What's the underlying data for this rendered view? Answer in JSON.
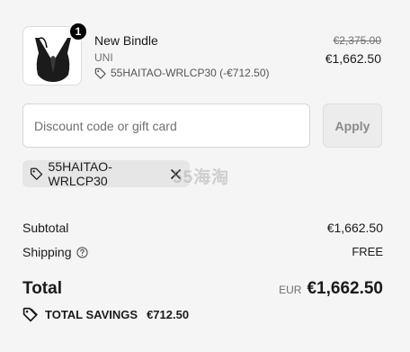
{
  "product": {
    "quantity": "1",
    "name": "New Bindle",
    "variant": "UNI",
    "discount_line": "55HAITAO-WRLCP30 (-€712.50)",
    "original_price": "€2,375.00",
    "price": "€1,662.50",
    "image_icon": "handbag-icon"
  },
  "discount": {
    "placeholder": "Discount code or gift card",
    "apply_label": "Apply",
    "applied_code": "55HAITAO-WRLCP30",
    "watermark": "55海淘"
  },
  "summary": {
    "subtotal_label": "Subtotal",
    "subtotal_value": "€1,662.50",
    "shipping_label": "Shipping",
    "shipping_value": "FREE",
    "total_label": "Total",
    "total_currency": "EUR",
    "total_value": "€1,662.50",
    "savings_label": "TOTAL SAVINGS",
    "savings_value": "€712.50"
  },
  "colors": {
    "background": "#f5f5f5",
    "text": "#1a1a1a",
    "muted": "#707070",
    "chip": "#e6e6e6",
    "badge": "#000000"
  }
}
